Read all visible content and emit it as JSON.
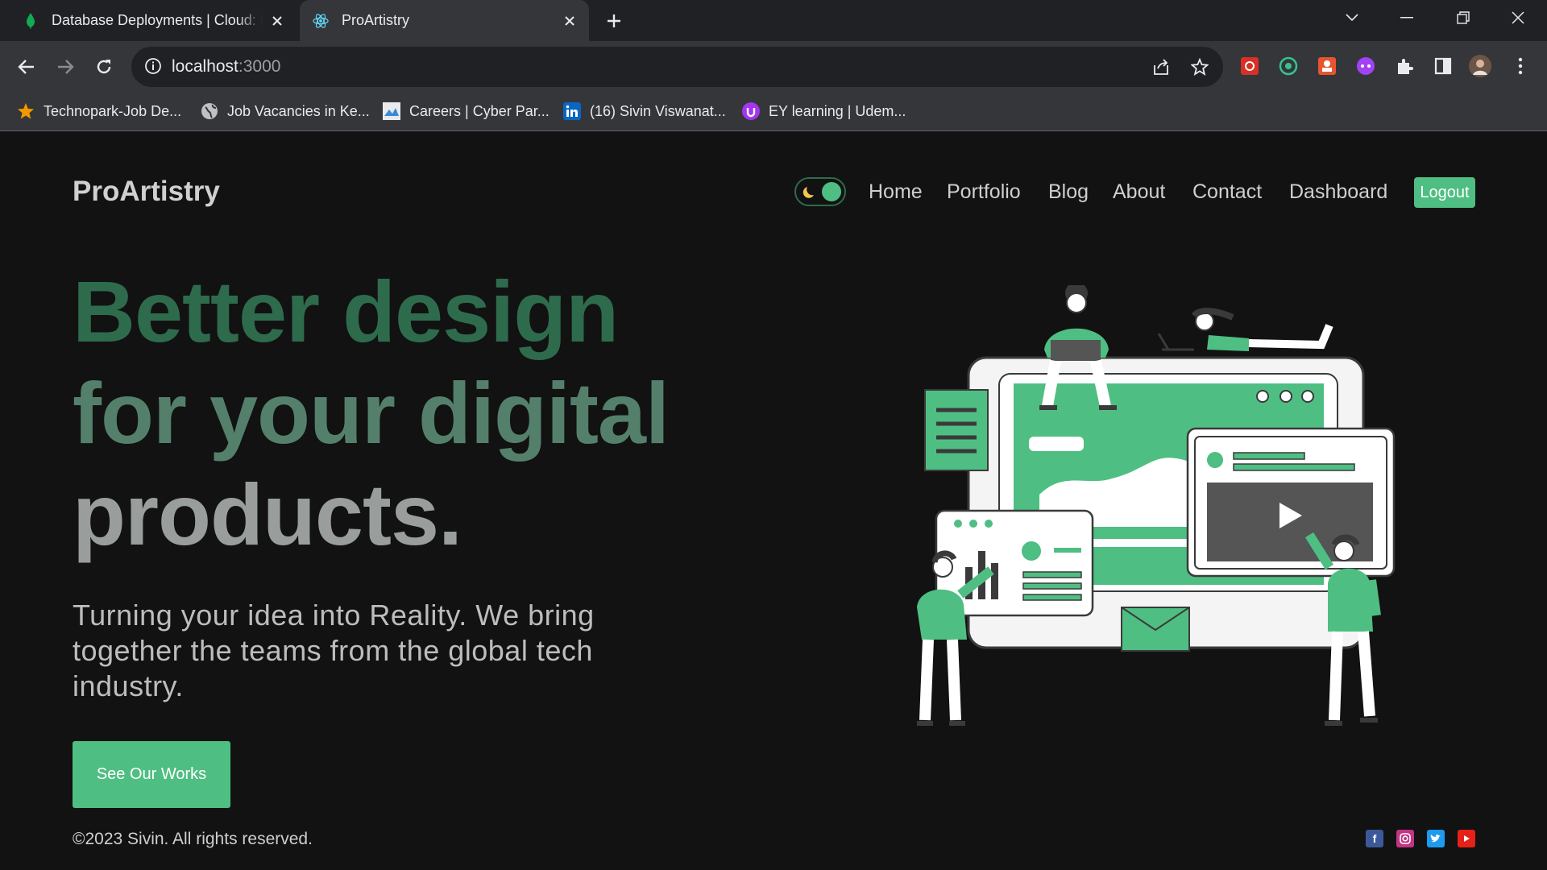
{
  "browser": {
    "tabs": [
      {
        "title": "Database Deployments | Cloud: MongoDB Cloud",
        "favicon": "mongodb-leaf-icon",
        "active": false
      },
      {
        "title": "ProArtistry",
        "favicon": "react-icon",
        "active": true
      }
    ],
    "address": {
      "host": "localhost",
      "port": ":3000"
    },
    "bookmarks": [
      {
        "label": "Technopark-Job De...",
        "icon": "star-icon"
      },
      {
        "label": "Job Vacancies in Ke...",
        "icon": "globe-icon"
      },
      {
        "label": "Careers | Cyber Par...",
        "icon": "cyberpark-icon"
      },
      {
        "label": "(16) Sivin Viswanat...",
        "icon": "linkedin-icon"
      },
      {
        "label": "EY learning | Udem...",
        "icon": "udemy-icon"
      }
    ]
  },
  "site": {
    "brand": "ProArtistry",
    "nav": [
      "Home",
      "Portfolio",
      "Blog",
      "About",
      "Contact",
      "Dashboard"
    ],
    "logout": "Logout",
    "hero": {
      "line1": "Better design",
      "line2": "for your digital",
      "line3": "products.",
      "subtitle": "Turning your idea into Reality. We bring together the teams from the global tech industry.",
      "cta": "See Our Works"
    },
    "footer": {
      "copyright": "©2023 Sivin. All rights reserved.",
      "social": [
        "facebook-icon",
        "instagram-icon",
        "twitter-icon",
        "youtube-icon"
      ]
    },
    "colors": {
      "accent": "#4fbe82",
      "background": "#121212",
      "hero_line1": "#2e6b4d",
      "hero_line2": "#54806b",
      "hero_line3": "#999e9c"
    }
  }
}
